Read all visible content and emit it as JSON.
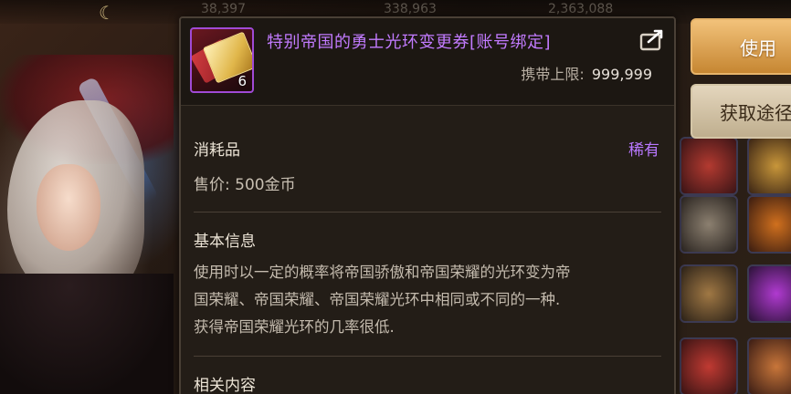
{
  "top_bar": {
    "values": [
      "38,397",
      "338,963",
      "2,363,088"
    ]
  },
  "item": {
    "name": "特别帝国的勇士光环变更券[账号绑定]",
    "count": "6",
    "carry_limit_label": "携带上限:",
    "carry_limit_value": "999,999",
    "type": "消耗品",
    "rarity": "稀有",
    "price": "售价: 500金币",
    "rarity_color": "#b878ff",
    "name_color": "#c27bff",
    "icon": "gold-ticket-icon"
  },
  "sections": {
    "basic_info_title": "基本信息",
    "description_line1": "使用时以一定的概率将帝国骄傲和帝国荣耀的光环变为帝",
    "description_line2": "国荣耀、帝国荣耀、帝国荣耀光环中相同或不同的一种.",
    "description_line3": "获得帝国荣耀光环的几率很低.",
    "related_title": "相关内容"
  },
  "actions": {
    "use_label": "使用",
    "source_label": "获取途径"
  }
}
